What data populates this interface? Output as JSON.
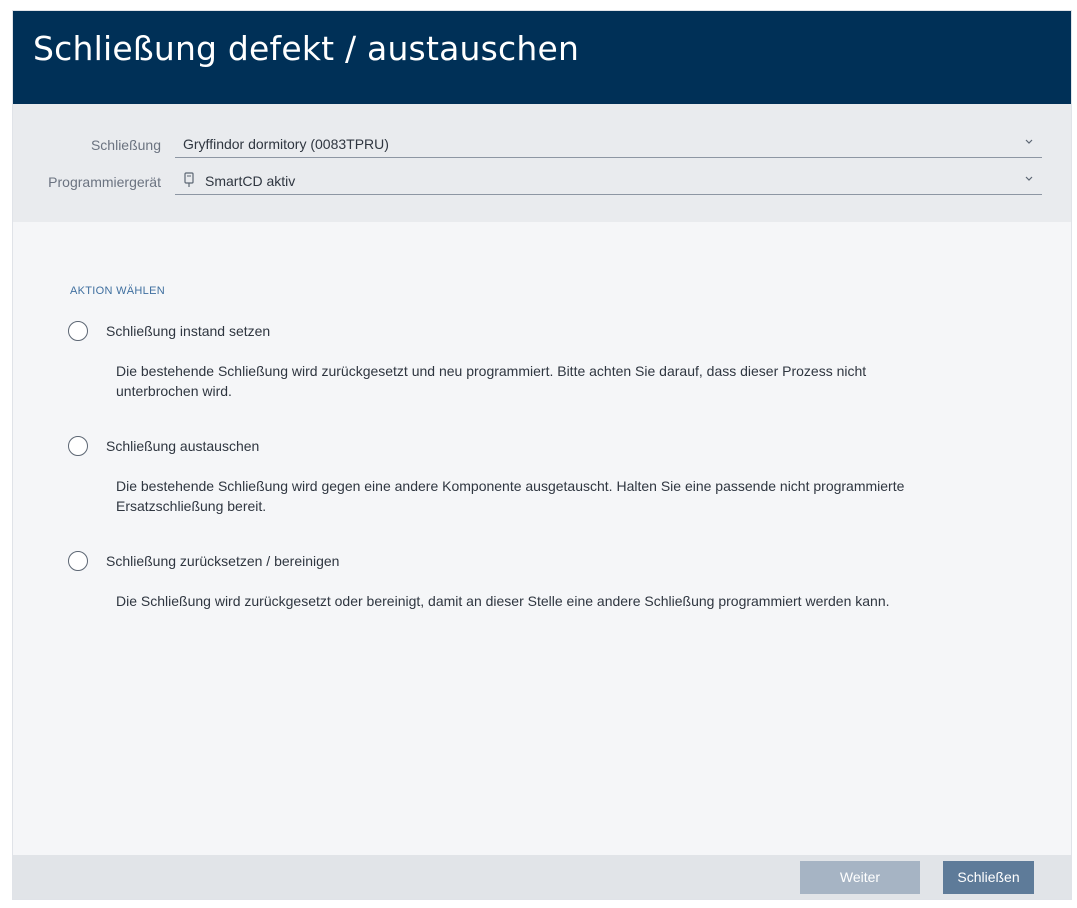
{
  "dialog": {
    "title": "Schließung defekt / austauschen"
  },
  "selectors": {
    "lock_label": "Schließung",
    "lock_value": "Gryffindor dormitory (0083TPRU)",
    "device_label": "Programmiergerät",
    "device_value": "SmartCD aktiv",
    "device_icon": "smartcd-device-icon",
    "dropdown_icon": "chevron-down-icon"
  },
  "action": {
    "heading": "AKTION WÄHLEN",
    "options": [
      {
        "label": "Schließung instand setzen",
        "description": "Die bestehende Schließung wird zurückgesetzt und neu programmiert. Bitte achten Sie darauf, dass dieser Prozess nicht unterbrochen wird.",
        "selected": false
      },
      {
        "label": "Schließung austauschen",
        "description": "Die bestehende Schließung wird gegen eine andere Komponente ausgetauscht. Halten Sie eine passende nicht programmierte Ersatzschließung bereit.",
        "selected": false
      },
      {
        "label": "Schließung zurücksetzen / bereinigen",
        "description": "Die Schließung wird zurückgesetzt oder bereinigt, damit an dieser Stelle eine andere Schließung programmiert werden kann.",
        "selected": false
      }
    ]
  },
  "footer": {
    "next_label": "Weiter",
    "close_label": "Schließen"
  },
  "colors": {
    "title_bar": "#003057",
    "accent_heading": "#3f6f9f",
    "button_disabled": "#a6b4c4",
    "button_primary": "#5e7b99"
  }
}
